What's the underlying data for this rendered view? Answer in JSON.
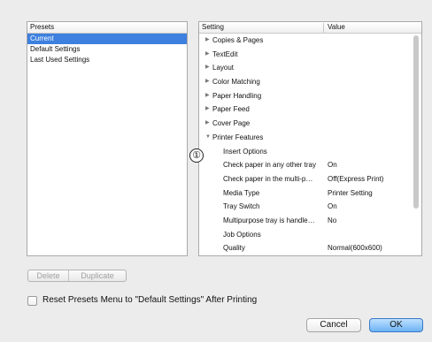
{
  "presets": {
    "header": "Presets",
    "items": [
      "Current",
      "Default Settings",
      "Last Used Settings"
    ],
    "selected_index": 0
  },
  "settings": {
    "header_setting": "Setting",
    "header_value": "Value",
    "rows": [
      {
        "label": "Copies & Pages",
        "value": "",
        "level": 0,
        "expanded": false
      },
      {
        "label": "TextEdit",
        "value": "",
        "level": 0,
        "expanded": false
      },
      {
        "label": "Layout",
        "value": "",
        "level": 0,
        "expanded": false
      },
      {
        "label": "Color Matching",
        "value": "",
        "level": 0,
        "expanded": false
      },
      {
        "label": "Paper Handling",
        "value": "",
        "level": 0,
        "expanded": false
      },
      {
        "label": "Paper Feed",
        "value": "",
        "level": 0,
        "expanded": false
      },
      {
        "label": "Cover Page",
        "value": "",
        "level": 0,
        "expanded": false
      },
      {
        "label": "Printer Features",
        "value": "",
        "level": 0,
        "expanded": true
      },
      {
        "label": "Insert Options",
        "value": "",
        "level": 1
      },
      {
        "label": "Check paper in any other tray",
        "value": "On",
        "level": 1
      },
      {
        "label": "Check paper in the multi-p…",
        "value": "Off(Express Print)",
        "level": 1
      },
      {
        "label": "Media Type",
        "value": "Printer Setting",
        "level": 1
      },
      {
        "label": "Tray Switch",
        "value": "On",
        "level": 1
      },
      {
        "label": "Multipurpose tray is handle…",
        "value": "No",
        "level": 1
      },
      {
        "label": "Job Options",
        "value": "",
        "level": 1
      },
      {
        "label": "Quality",
        "value": "Normal(600x600)",
        "level": 1
      }
    ]
  },
  "callout_label": "①",
  "buttons": {
    "delete": "Delete",
    "duplicate": "Duplicate",
    "cancel": "Cancel",
    "ok": "OK"
  },
  "reset_checkbox": {
    "label": "Reset Presets Menu to \"Default Settings\" After Printing",
    "checked": false
  },
  "colors": {
    "selection": "#3d80df",
    "ok_button": "#6cb3f3"
  }
}
